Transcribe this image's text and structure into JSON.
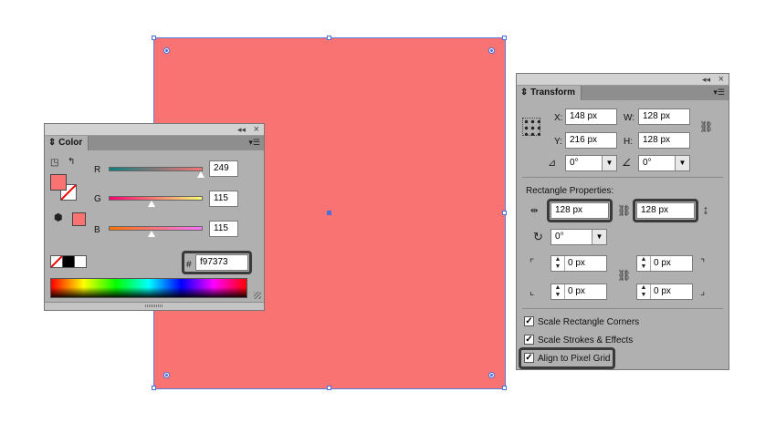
{
  "canvas": {
    "fill_color": "#f97373",
    "selection_color": "#4a6fd8"
  },
  "color_panel": {
    "tab_label": "Color",
    "collapse_glyph": "◂◂",
    "close_glyph": "×",
    "menu_glyph": "▾☰",
    "fill_color": "#f97373",
    "sliders": [
      {
        "label": "R",
        "value": "249",
        "level": 0.976,
        "gradient": [
          "#0b7f7f",
          "#fb7373"
        ]
      },
      {
        "label": "G",
        "value": "115",
        "level": 0.451,
        "gradient": [
          "#f90073",
          "#f9ff73"
        ]
      },
      {
        "label": "B",
        "value": "115",
        "level": 0.451,
        "gradient": [
          "#f97300",
          "#f973ff"
        ]
      }
    ],
    "hex_label": "#",
    "hex_value": "f97373"
  },
  "transform_panel": {
    "tab_label": "Transform",
    "collapse_glyph": "◂◂",
    "close_glyph": "×",
    "menu_glyph": "▾☰",
    "x_label": "X:",
    "x_value": "148 px",
    "y_label": "Y:",
    "y_value": "216 px",
    "w_label": "W:",
    "w_value": "128 px",
    "h_label": "H:",
    "h_value": "128 px",
    "rotate_value": "0°",
    "shear_value": "0°",
    "rect_props_title": "Rectangle Properties:",
    "rect_width": "128 px",
    "rect_height": "128 px",
    "rect_rotate": "0°",
    "corner_tl": "0 px",
    "corner_tr": "0 px",
    "corner_bl": "0 px",
    "corner_br": "0 px",
    "checkboxes": [
      {
        "label": "Scale Rectangle Corners",
        "checked": true
      },
      {
        "label": "Scale Strokes & Effects",
        "checked": true
      },
      {
        "label": "Align to Pixel Grid",
        "checked": true
      }
    ]
  }
}
